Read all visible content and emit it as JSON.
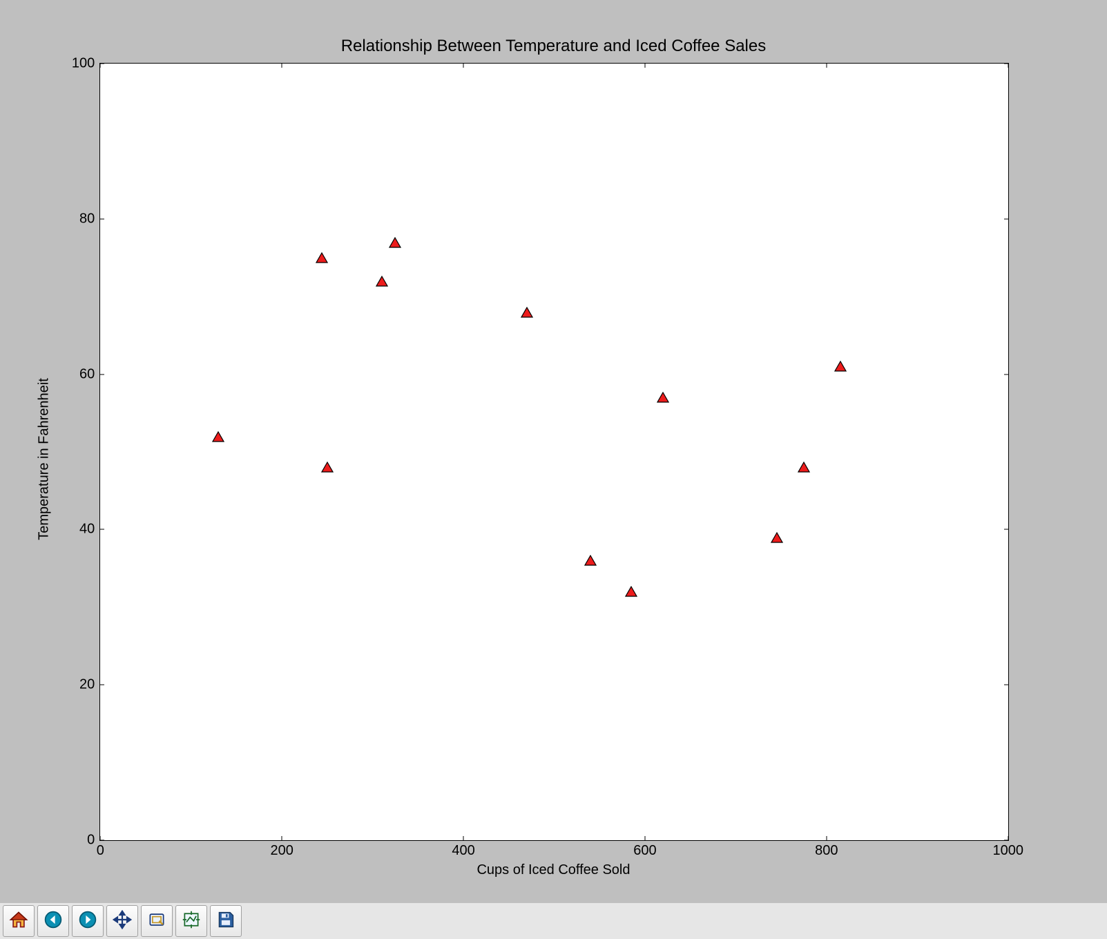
{
  "chart_data": {
    "type": "scatter",
    "title": "Relationship Between Temperature and Iced Coffee Sales",
    "xlabel": "Cups of Iced Coffee Sold",
    "ylabel": "Temperature in Fahrenheit",
    "xlim": [
      0,
      1000
    ],
    "ylim": [
      0,
      100
    ],
    "xticks": [
      0,
      200,
      400,
      600,
      800,
      1000
    ],
    "yticks": [
      0,
      20,
      40,
      60,
      80,
      100
    ],
    "marker": {
      "shape": "triangle",
      "face": "#ed1c1c",
      "edge": "#000000"
    },
    "points": [
      {
        "x": 130,
        "y": 52
      },
      {
        "x": 244,
        "y": 75
      },
      {
        "x": 250,
        "y": 48
      },
      {
        "x": 310,
        "y": 72
      },
      {
        "x": 325,
        "y": 77
      },
      {
        "x": 470,
        "y": 68
      },
      {
        "x": 540,
        "y": 36
      },
      {
        "x": 585,
        "y": 32
      },
      {
        "x": 620,
        "y": 57
      },
      {
        "x": 745,
        "y": 39
      },
      {
        "x": 775,
        "y": 48
      },
      {
        "x": 815,
        "y": 61
      }
    ]
  },
  "toolbar": {
    "items": [
      {
        "name": "home-button",
        "icon": "home"
      },
      {
        "name": "back-button",
        "icon": "arrow-left"
      },
      {
        "name": "forward-button",
        "icon": "arrow-right"
      },
      {
        "name": "pan-button",
        "icon": "move"
      },
      {
        "name": "zoom-button",
        "icon": "zoom-rect"
      },
      {
        "name": "subplots-button",
        "icon": "subplots"
      },
      {
        "name": "save-button",
        "icon": "floppy"
      }
    ]
  }
}
